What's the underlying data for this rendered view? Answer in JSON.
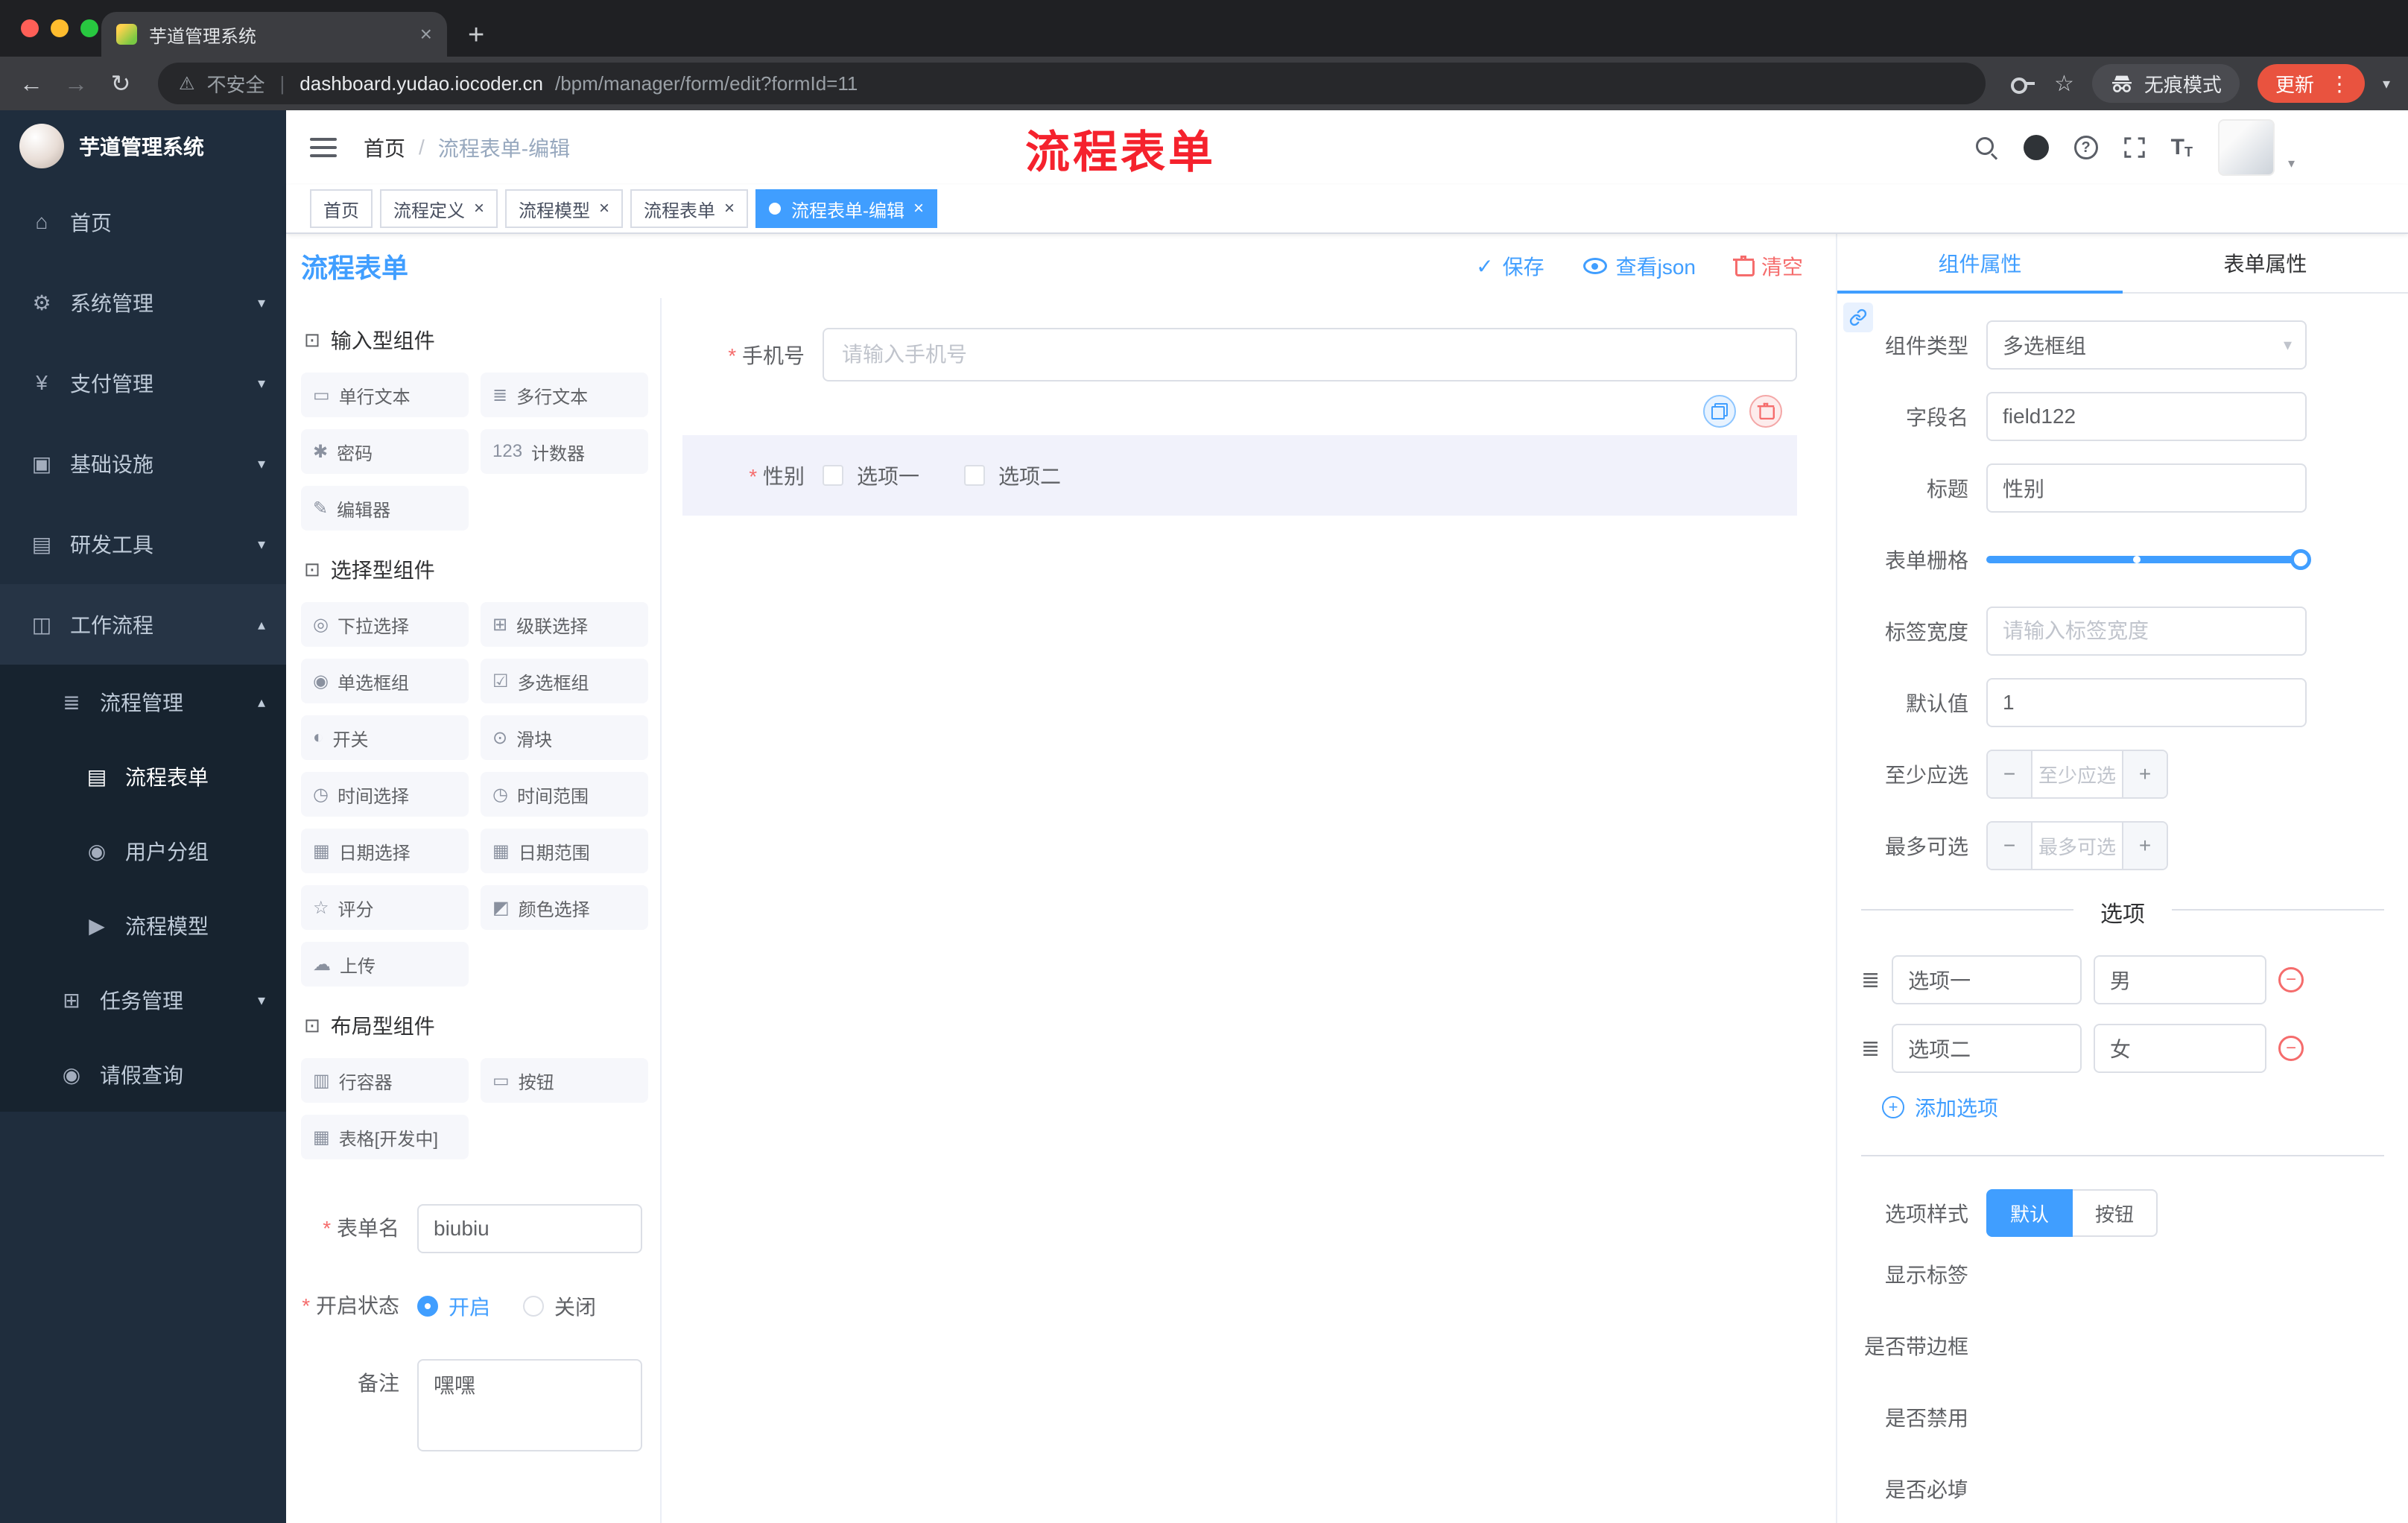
{
  "colors": {
    "accent": "#409EFF",
    "danger": "#F56C6C",
    "annotation_red": "#F5222D",
    "update_pill": "#E9533F",
    "sidebar_bg": "#1F2D3D",
    "active_tag_bg": "#409EFF"
  },
  "icons": {
    "back": "←",
    "forward": "→",
    "reload": "↻",
    "warning": "⚠",
    "star": "☆",
    "more_vertical": "⋮",
    "caret_down": "▾",
    "caret_up": "▴",
    "close": "×",
    "plus": "+",
    "minus": "−",
    "help": "?",
    "check": "✓",
    "drag_handle": "≣",
    "font_size_big": "T",
    "font_size_small": "T",
    "new_tab": "+",
    "section_cube": "⊡"
  },
  "browser": {
    "tab_title": "芋道管理系统",
    "security_label": "不安全",
    "url_host": "dashboard.yudao.iocoder.cn",
    "url_path": "/bpm/manager/form/edit?formId=11",
    "incognito_label": "无痕模式",
    "update_label": "更新"
  },
  "sidebar": {
    "logo_title": "芋道管理系统",
    "menu": [
      {
        "label": "首页",
        "icon": "⌂"
      },
      {
        "label": "系统管理",
        "icon": "⚙"
      },
      {
        "label": "支付管理",
        "icon": "¥"
      },
      {
        "label": "基础设施",
        "icon": "▣"
      },
      {
        "label": "研发工具",
        "icon": "▤"
      },
      {
        "label": "工作流程",
        "icon": "◫"
      }
    ],
    "submenu": [
      {
        "label": "流程管理",
        "icon": "≣"
      },
      {
        "label": "流程表单",
        "icon": "▤"
      },
      {
        "label": "用户分组",
        "icon": "◉"
      },
      {
        "label": "流程模型",
        "icon": "▶"
      },
      {
        "label": "任务管理",
        "icon": "⊞"
      },
      {
        "label": "请假查询",
        "icon": "◉"
      }
    ]
  },
  "header": {
    "breadcrumb_home": "首页",
    "breadcrumb_current": "流程表单-编辑",
    "annotation": "流程表单"
  },
  "tags": [
    {
      "label": "首页"
    },
    {
      "label": "流程定义"
    },
    {
      "label": "流程模型"
    },
    {
      "label": "流程表单"
    },
    {
      "label": "流程表单-编辑"
    }
  ],
  "designer": {
    "title": "流程表单",
    "save_label": "保存",
    "view_json_label": "查看json",
    "clear_label": "清空"
  },
  "palette": {
    "input_section_title": "输入型组件",
    "select_section_title": "选择型组件",
    "layout_section_title": "布局型组件",
    "input_items": [
      {
        "label": "单行文本",
        "icon": "▭"
      },
      {
        "label": "多行文本",
        "icon": "≣"
      },
      {
        "label": "密码",
        "icon": "✱"
      },
      {
        "label": "计数器",
        "icon": "123"
      },
      {
        "label": "编辑器",
        "icon": "✎"
      }
    ],
    "select_items": [
      {
        "label": "下拉选择",
        "icon": "◎"
      },
      {
        "label": "级联选择",
        "icon": "⊞"
      },
      {
        "label": "单选框组",
        "icon": "◉"
      },
      {
        "label": "多选框组",
        "icon": "☑"
      },
      {
        "label": "开关",
        "icon": "◐"
      },
      {
        "label": "滑块",
        "icon": "⊙"
      },
      {
        "label": "时间选择",
        "icon": "◷"
      },
      {
        "label": "时间范围",
        "icon": "◷"
      },
      {
        "label": "日期选择",
        "icon": "▦"
      },
      {
        "label": "日期范围",
        "icon": "▦"
      },
      {
        "label": "评分",
        "icon": "☆"
      },
      {
        "label": "颜色选择",
        "icon": "◩"
      },
      {
        "label": "上传",
        "icon": "☁"
      }
    ],
    "layout_items": [
      {
        "label": "行容器",
        "icon": "▥"
      },
      {
        "label": "按钮",
        "icon": "▭"
      },
      {
        "label": "表格[开发中]",
        "icon": "▦"
      }
    ],
    "form": {
      "name_label": "表单名",
      "name_value": "biubiu",
      "status_label": "开启状态",
      "status_on": "开启",
      "status_off": "关闭",
      "remark_label": "备注",
      "remark_value": "嘿嘿"
    }
  },
  "canvas": {
    "phone_label": "手机号",
    "phone_placeholder": "请输入手机号",
    "gender_label": "性别",
    "gender_option1": "选项一",
    "gender_option2": "选项二"
  },
  "props": {
    "tab_component": "组件属性",
    "tab_form": "表单属性",
    "component_type_label": "组件类型",
    "component_type_value": "多选框组",
    "field_name_label": "字段名",
    "field_name_value": "field122",
    "title_label": "标题",
    "title_value": "性别",
    "grid_label": "表单栅格",
    "label_width_label": "标签宽度",
    "label_width_placeholder": "请输入标签宽度",
    "default_label": "默认值",
    "default_value": "1",
    "min_select_label": "至少应选",
    "min_select_placeholder": "至少应选",
    "max_select_label": "最多可选",
    "max_select_placeholder": "最多可选",
    "options_title": "选项",
    "options": [
      {
        "label": "选项一",
        "value": "男"
      },
      {
        "label": "选项二",
        "value": "女"
      }
    ],
    "add_option_label": "添加选项",
    "option_style_label": "选项样式",
    "option_style_default": "默认",
    "option_style_button": "按钮",
    "toggles": [
      {
        "label": "显示标签",
        "on": true
      },
      {
        "label": "是否带边框",
        "on": false
      },
      {
        "label": "是否禁用",
        "on": false
      },
      {
        "label": "是否必填",
        "on": true
      }
    ]
  }
}
